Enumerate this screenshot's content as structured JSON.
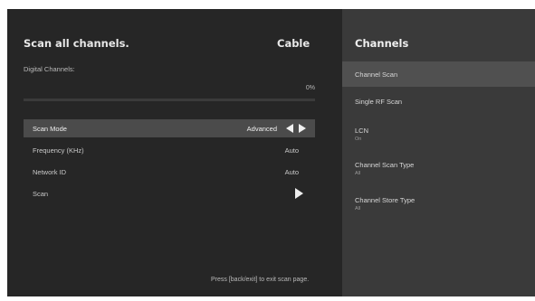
{
  "scan_panel": {
    "title": "Scan all channels.",
    "signal_type": "Cable",
    "digital_channels_label": "Digital Channels:",
    "progress_percent": 0,
    "progress_text": "0%",
    "rows": [
      {
        "label": "Scan Mode",
        "value": "Advanced",
        "selected": true
      },
      {
        "label": "Frequency (KHz)",
        "value": "Auto"
      },
      {
        "label": "Network ID",
        "value": "Auto"
      },
      {
        "label": "Scan",
        "value": ""
      }
    ],
    "footer_hint": "Press [back/exit] to exit scan page."
  },
  "sidebar": {
    "title": "Channels",
    "items": [
      {
        "label": "Channel Scan",
        "sub": "",
        "active": true
      },
      {
        "label": "Single RF Scan",
        "sub": ""
      },
      {
        "label": "LCN",
        "sub": "On"
      },
      {
        "label": "Channel Scan Type",
        "sub": "All"
      },
      {
        "label": "Channel Store Type",
        "sub": "All"
      }
    ]
  },
  "icons": {
    "scan_mode_arrows": "left-right-arrows-icon",
    "scan_start": "play-icon"
  },
  "colors": {
    "panel_bg": "#262626",
    "sidebar_bg": "#3a3a3a",
    "selected_row_bg": "#4b4b4b",
    "active_menu_bg": "#505050"
  }
}
